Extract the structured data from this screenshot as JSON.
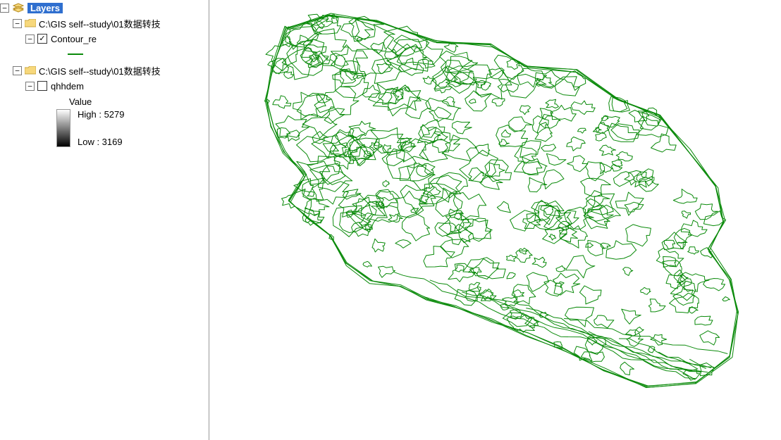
{
  "toc": {
    "root_label": "Layers",
    "group1": {
      "path": "C:\\GIS  self--study\\01数据转技",
      "layer_name": "Contour_re",
      "layer_checked": true,
      "swatch_color": "#0a8a0a"
    },
    "group2": {
      "path": "C:\\GIS  self--study\\01数据转技",
      "layer_name": "qhhdem",
      "layer_checked": false,
      "value_heading": "Value",
      "high_label": "High : 5279",
      "low_label": "Low : 3169"
    }
  },
  "map": {
    "visible_layer": "Contour_re",
    "style": {
      "stroke": "#0a8a0a",
      "type": "contour-lines"
    }
  }
}
